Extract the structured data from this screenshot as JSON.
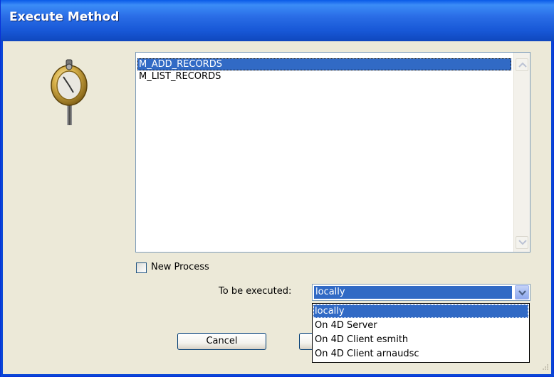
{
  "window": {
    "title": "Execute Method"
  },
  "methods": {
    "items": [
      {
        "label": "M_ADD_RECORDS",
        "selected": true
      },
      {
        "label": "M_LIST_RECORDS",
        "selected": false
      }
    ]
  },
  "new_process": {
    "label": "New Process",
    "checked": false
  },
  "execution": {
    "label": "To be executed:",
    "selected": "locally",
    "options": [
      "locally",
      "On 4D Server",
      "On 4D Client esmith",
      "On 4D Client arnaudsc"
    ]
  },
  "buttons": {
    "cancel": "Cancel",
    "ok": ""
  },
  "icons": {
    "method": "method-execute-icon",
    "accent": "#316ac5"
  }
}
